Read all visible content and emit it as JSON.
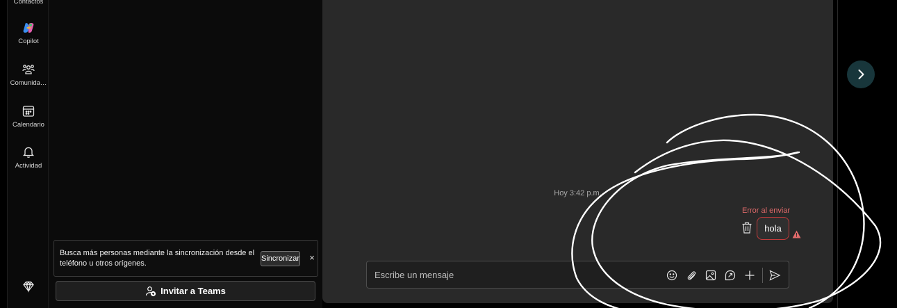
{
  "rail": {
    "top_partial_label": "Contactos",
    "items": [
      {
        "label": "Copilot",
        "icon": "copilot-icon"
      },
      {
        "label": "Comunida…",
        "icon": "communities-icon"
      },
      {
        "label": "Calendario",
        "icon": "calendar-icon"
      },
      {
        "label": "Actividad",
        "icon": "bell-icon"
      }
    ],
    "bottom_icon": "diamond-icon"
  },
  "sync_banner": {
    "text": "Busca más personas mediante la sincronización desde el teléfono u otros orígenes.",
    "button_label": "Sincronizar",
    "close_glyph": "×"
  },
  "invite": {
    "label": "Invitar a Teams",
    "icon": "person-add-icon"
  },
  "chat": {
    "timestamp": "Hoy 3:42 p.m.",
    "message": {
      "status": "Error al enviar",
      "text": "hola",
      "status_color": "#e06a6a"
    },
    "composer": {
      "placeholder": "Escribe un mensaje",
      "value": "",
      "actions": [
        "emoji-icon",
        "attach-icon",
        "image-icon",
        "loop-icon",
        "plus-icon",
        "send-icon"
      ]
    }
  },
  "colors": {
    "accent_button": "#18363b",
    "error": "#c23b3b"
  }
}
